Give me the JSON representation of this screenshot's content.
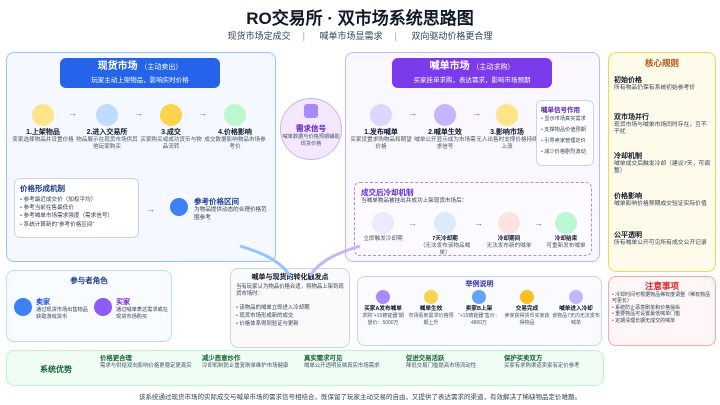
{
  "header": {
    "title": "RO交易所 · 双市场系统思路图",
    "subtitle_items": [
      "现货市场定成交",
      "喊单市场显需求",
      "双向驱动价格更合理"
    ]
  },
  "spot": {
    "title": "现货市场",
    "title_note": "（主动卖出）",
    "tagline": "玩家主动上架物品，影响实时价格",
    "steps": [
      {
        "title": "1.上架物品",
        "desc": "卖家选择物品并设置价格"
      },
      {
        "title": "2.进入交易所",
        "desc": "物品展示在现货市场供其他玩家购买"
      },
      {
        "title": "3.成交",
        "desc": "买家购买或成功货币与物品流转"
      },
      {
        "title": "4.价格影响",
        "desc": "成交数据影响物品市场参考价"
      }
    ],
    "mechanism": {
      "title": "价格形成机制",
      "items": [
        "参考最近成交价（加权平均）",
        "参考当前在售最低价",
        "参考喊单市场需求强度（需求信号）",
        "系统计算新的“参考价格区间”"
      ]
    },
    "ref": {
      "title": "参考价格区间",
      "desc": "为物品提供动态的合理价格范围参考"
    }
  },
  "signal": {
    "title": "需求信号",
    "desc": "喊单数据与价格预期辅助现货价格"
  },
  "order": {
    "title": "喊单市场",
    "title_note": "（主动求购）",
    "tagline": "买家挂单求购，表达需求，影响市场预期",
    "steps": [
      {
        "title": "1.发布喊单",
        "desc": "买家设置求购物品和期望价格"
      },
      {
        "title": "2.喊单生效",
        "desc": "喊单公开显示成为市场需求信号"
      },
      {
        "title": "3.影响市场",
        "desc": "无人出售时支撑价格持续上涨"
      }
    ],
    "effects": {
      "title": "喊单信号作用",
      "items": [
        "显示市场真实需求",
        "支撑物品价值预期",
        "引导卖家管理定价",
        "减少价格剧烈波动"
      ]
    },
    "cooldown": {
      "title": "成交后冷却机制",
      "desc": "当喊单物品被挂出并成功上架现货市场后：",
      "stages": [
        {
          "title": "立即触发冷却期",
          "desc": ""
        },
        {
          "title": "7天冷却期",
          "desc": "（无法发布该物品喊单）"
        },
        {
          "title": "冷却期间",
          "desc": "无法发布新的喊单"
        },
        {
          "title": "冷却结束",
          "desc": "可重新发布喊单"
        }
      ]
    }
  },
  "rules": {
    "title": "核心规则",
    "items": [
      {
        "title": "初始价格",
        "desc": "所有物品仍保有系统初始参考价"
      },
      {
        "title": "双市场并行",
        "desc": "现货市场与喊单市场同时存在，互不干扰"
      },
      {
        "title": "冷却机制",
        "desc": "喊单成交后触发冷却（建议7天，可调整）"
      },
      {
        "title": "价格影响",
        "desc": "喊单影响价格预期成交验证实际价值"
      },
      {
        "title": "公平透明",
        "desc": "所有喊单公开可见所有成交公开记录"
      }
    ]
  },
  "notes": {
    "title": "注意事项",
    "items": [
      "冷却时间可根据物品稀有度调整（稀有物品可更长）",
      "系统防止恶意刷单和价格操纵",
      "重要物品可设置最低喊单门槛",
      "定期清理长期无成交的喊单"
    ]
  },
  "roles": {
    "title": "参与者角色",
    "seller": {
      "title": "卖家",
      "desc": "通过现货市场出售物品获取游戏货币"
    },
    "buyer": {
      "title": "买家",
      "desc": "通过喊单表达需求或在现货市场购买"
    }
  },
  "transform": {
    "title": "喊单与现货的转化触发点",
    "lead": "当有玩家认为物品价格合适，将物品上架到现货市场时：",
    "items": [
      "该物品的喊单立即进入冷却期",
      "现货市场形成新的成交",
      "价格体系得到验证与更新"
    ]
  },
  "example": {
    "title": "举例说明",
    "steps": [
      {
        "title": "买家A发布喊单",
        "desc": "求购“+15铸锭器”期望价：5000万"
      },
      {
        "title": "喊单生效",
        "desc": "市场看到需求价格预期上升"
      },
      {
        "title": "卖家B上架",
        "desc": "“+15铸锭器”售价：4800万"
      },
      {
        "title": "交易完成",
        "desc": "卖家获得货币买家获得物品"
      },
      {
        "title": "喊单进入冷却",
        "desc": "该物品7天内无法发布喊单"
      }
    ]
  },
  "advantages": {
    "label": "系统优势",
    "items": [
      {
        "title": "价格更合理",
        "desc": "需求与供给双向影响价格更稳定更真实"
      },
      {
        "title": "减少恶意炒作",
        "desc": "冷却机制防止重复刷单维护市场健康"
      },
      {
        "title": "真实需求可见",
        "desc": "喊单公开透明反映真实市场需求"
      },
      {
        "title": "促进交易活跃",
        "desc": "降低交易门槛提高市场流动性"
      },
      {
        "title": "保护买卖双方",
        "desc": "买家有求购渠道卖家有定价参考"
      }
    ]
  },
  "footer": "该系统通过现货市场的实际成交与喊单市场的需求信号相结合，既保留了玩家主动交易的自由，又提供了表达需求的渠道，有效解决了稀缺物品定价难题。",
  "colors": {
    "spot": "#2563eb",
    "order": "#7c3aed",
    "rules": "#d97706",
    "notes": "#dc2626",
    "adv": "#16a34a"
  }
}
